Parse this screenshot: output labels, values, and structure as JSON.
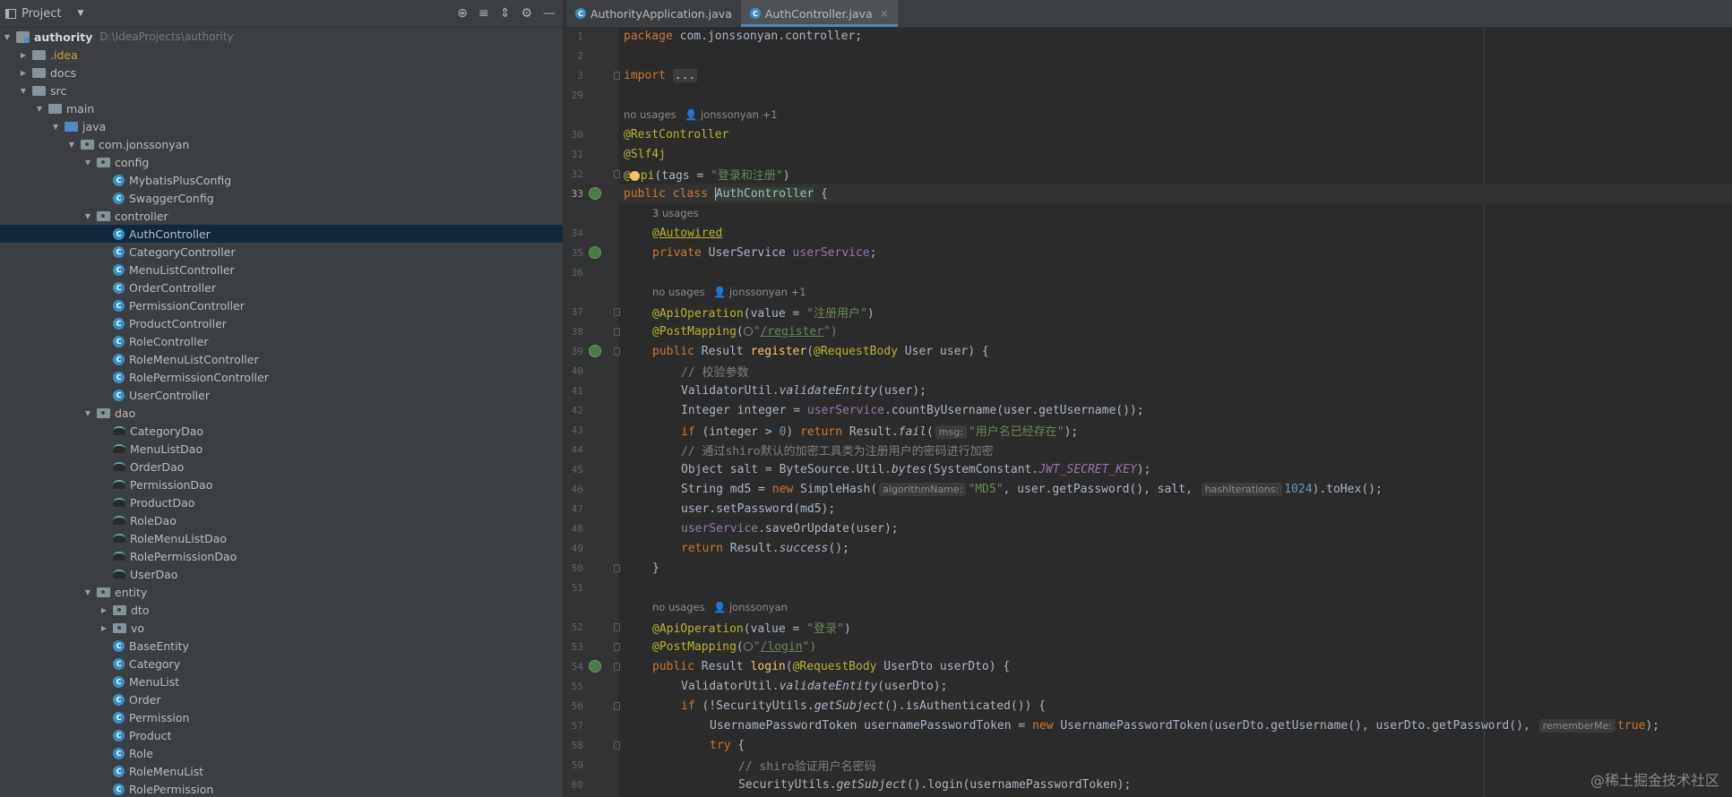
{
  "project_panel": {
    "title": "Project",
    "dropdown_icon": "chevron-down-icon",
    "toolbar_icons": [
      "locate-icon",
      "expand-all-icon",
      "collapse-all-icon",
      "gear-icon",
      "minimize-icon"
    ],
    "root_name": "authority",
    "root_path": "D:\\IdeaProjects\\authority",
    "tree": [
      {
        "label": ".idea",
        "kind": "folder-idea",
        "arrow": "right"
      },
      {
        "label": "docs",
        "kind": "folder",
        "arrow": "right"
      },
      {
        "label": "src",
        "kind": "folder",
        "arrow": "down"
      },
      {
        "label": "main",
        "kind": "folder",
        "arrow": "down"
      },
      {
        "label": "java",
        "kind": "folder-src",
        "arrow": "down"
      },
      {
        "label": "com.jonssonyan",
        "kind": "package",
        "arrow": "down"
      },
      {
        "label": "config",
        "kind": "package",
        "arrow": "down"
      },
      {
        "label": "MybatisPlusConfig",
        "kind": "class",
        "arrow": ""
      },
      {
        "label": "SwaggerConfig",
        "kind": "class",
        "arrow": ""
      },
      {
        "label": "controller",
        "kind": "package",
        "arrow": "down"
      },
      {
        "label": "AuthController",
        "kind": "class",
        "arrow": "",
        "selected": true
      },
      {
        "label": "CategoryController",
        "kind": "class",
        "arrow": ""
      },
      {
        "label": "MenuListController",
        "kind": "class",
        "arrow": ""
      },
      {
        "label": "OrderController",
        "kind": "class",
        "arrow": ""
      },
      {
        "label": "PermissionController",
        "kind": "class",
        "arrow": ""
      },
      {
        "label": "ProductController",
        "kind": "class",
        "arrow": ""
      },
      {
        "label": "RoleController",
        "kind": "class",
        "arrow": ""
      },
      {
        "label": "RoleMenuListController",
        "kind": "class",
        "arrow": ""
      },
      {
        "label": "RolePermissionController",
        "kind": "class",
        "arrow": ""
      },
      {
        "label": "UserController",
        "kind": "class",
        "arrow": ""
      },
      {
        "label": "dao",
        "kind": "package",
        "arrow": "down"
      },
      {
        "label": "CategoryDao",
        "kind": "mapper",
        "arrow": ""
      },
      {
        "label": "MenuListDao",
        "kind": "mapper",
        "arrow": ""
      },
      {
        "label": "OrderDao",
        "kind": "mapper",
        "arrow": ""
      },
      {
        "label": "PermissionDao",
        "kind": "mapper",
        "arrow": ""
      },
      {
        "label": "ProductDao",
        "kind": "mapper",
        "arrow": ""
      },
      {
        "label": "RoleDao",
        "kind": "mapper",
        "arrow": ""
      },
      {
        "label": "RoleMenuListDao",
        "kind": "mapper",
        "arrow": ""
      },
      {
        "label": "RolePermissionDao",
        "kind": "mapper",
        "arrow": ""
      },
      {
        "label": "UserDao",
        "kind": "mapper",
        "arrow": ""
      },
      {
        "label": "entity",
        "kind": "package",
        "arrow": "down"
      },
      {
        "label": "dto",
        "kind": "package",
        "arrow": "right"
      },
      {
        "label": "vo",
        "kind": "package",
        "arrow": "right"
      },
      {
        "label": "BaseEntity",
        "kind": "class",
        "arrow": ""
      },
      {
        "label": "Category",
        "kind": "class",
        "arrow": ""
      },
      {
        "label": "MenuList",
        "kind": "class",
        "arrow": ""
      },
      {
        "label": "Order",
        "kind": "class",
        "arrow": ""
      },
      {
        "label": "Permission",
        "kind": "class",
        "arrow": ""
      },
      {
        "label": "Product",
        "kind": "class",
        "arrow": ""
      },
      {
        "label": "Role",
        "kind": "class",
        "arrow": ""
      },
      {
        "label": "RoleMenuList",
        "kind": "class",
        "arrow": ""
      },
      {
        "label": "RolePermission",
        "kind": "class",
        "arrow": ""
      }
    ]
  },
  "editor": {
    "tabs": [
      {
        "label": "AuthorityApplication.java",
        "active": false
      },
      {
        "label": "AuthController.java",
        "active": true,
        "close": "×"
      }
    ],
    "inlays": {
      "class_usages": "no usages",
      "class_author": "jonssonyan +1",
      "field_usages": "3 usages",
      "register_usages": "no usages",
      "register_author": "jonssonyan +1",
      "login_usages": "no usages",
      "login_author": "jonssonyan"
    },
    "line_numbers": [
      "1",
      "2",
      "3",
      "29",
      "30",
      "31",
      "32",
      "33",
      "34",
      "35",
      "36",
      "37",
      "38",
      "39",
      "40",
      "41",
      "42",
      "43",
      "44",
      "45",
      "46",
      "47",
      "48",
      "49",
      "50",
      "51",
      "52",
      "53",
      "54",
      "55",
      "56",
      "57",
      "58",
      "59",
      "60"
    ],
    "tokens": {
      "l1_kw": "package",
      "l1_rest": " com.jonssonyan.controller;",
      "l3_kw": "import",
      "l3_fold": "...",
      "l30": "@RestController",
      "l31": "@Slf4j",
      "l32_a": "@",
      "l32_b": "pi",
      "l32_rest": "(tags = ",
      "l32_str": "\"登录和注册\"",
      "l32_end": ")",
      "l33_kw": "public class ",
      "l33_name": "AuthController",
      "l33_end": " {",
      "l34": "@Autowired",
      "l35_kw": "private ",
      "l35_type": "UserService ",
      "l35_fld": "userService",
      "l35_end": ";",
      "l37_an": "@ApiOperation",
      "l37_rest": "(value = ",
      "l37_str": "\"注册用户\"",
      "l37_end": ")",
      "l38_an": "@PostMapping",
      "l38_open": "(",
      "l38_q": "\"",
      "l38_url": "/register",
      "l38_end": "\")",
      "l39_kw": "public ",
      "l39_a": "Result ",
      "l39_m": "register",
      "l39_b": "(",
      "l39_an": "@RequestBody",
      "l39_c": " User user) {",
      "l40": "// 校验参数",
      "l41_a": "ValidatorUtil.",
      "l41_m": "validateEntity",
      "l41_b": "(user);",
      "l42_a": "Integer integer = ",
      "l42_f": "userService",
      "l42_b": ".countByUsername(user.getUsername());",
      "l43_kw": "if",
      "l43_a": " (integer > ",
      "l43_n": "0",
      "l43_b": ") ",
      "l43_kw2": "return",
      "l43_c": " Result.",
      "l43_m": "fail",
      "l43_d": "(",
      "l43_hint": "msg:",
      "l43_str": "\"用户名已经存在\"",
      "l43_e": ");",
      "l44": "// 通过shiro默认的加密工具类为注册用户的密码进行加密",
      "l45_a": "Object salt = ByteSource.Util.",
      "l45_m": "bytes",
      "l45_b": "(SystemConstant.",
      "l45_c": "JWT_SECRET_KEY",
      "l45_d": ");",
      "l46_a": "String md5 = ",
      "l46_kw": "new",
      "l46_b": " SimpleHash(",
      "l46_h1": "algorithmName:",
      "l46_str": "\"MD5\"",
      "l46_c": ", user.getPassword(), salt, ",
      "l46_h2": "hashIterations:",
      "l46_n": "1024",
      "l46_d": ").toHex();",
      "l47": "user.setPassword(md5);",
      "l48_f": "userService",
      "l48_b": ".saveOrUpdate(user);",
      "l49_kw": "return",
      "l49_a": " Result.",
      "l49_m": "success",
      "l49_b": "();",
      "l50": "}",
      "l52_an": "@ApiOperation",
      "l52_rest": "(value = ",
      "l52_str": "\"登录\"",
      "l52_end": ")",
      "l53_an": "@PostMapping",
      "l53_open": "(",
      "l53_q": "\"",
      "l53_url": "/login",
      "l53_end": "\")",
      "l54_kw": "public ",
      "l54_a": "Result ",
      "l54_m": "login",
      "l54_b": "(",
      "l54_an": "@RequestBody",
      "l54_c": " UserDto userDto) {",
      "l55_a": "ValidatorUtil.",
      "l55_m": "validateEntity",
      "l55_b": "(userDto);",
      "l56_kw": "if",
      "l56_a": " (!SecurityUtils.",
      "l56_m": "getSubject",
      "l56_b": "().isAuthenticated()) {",
      "l57_a": "UsernamePasswordToken usernamePasswordToken = ",
      "l57_kw": "new",
      "l57_b": " UsernamePasswordToken(userDto.getUsername(), userDto.getPassword(), ",
      "l57_hint": "rememberMe:",
      "l57_kw2": "true",
      "l57_c": ");",
      "l58_kw": "try",
      "l58_b": " {",
      "l59": "// shiro验证用户名密码",
      "l60_a": "SecurityUtils.",
      "l60_m": "getSubject",
      "l60_b": "().login(usernamePasswordToken);"
    }
  },
  "watermark": "@稀土掘金技术社区",
  "colors": {
    "keyword": "#cc7832",
    "annotation": "#bbb529",
    "string": "#6a8759",
    "field": "#9876aa",
    "number": "#6897bb",
    "comment": "#808080",
    "selection": "#0d293e",
    "tab_underline": "#4a88c7"
  }
}
